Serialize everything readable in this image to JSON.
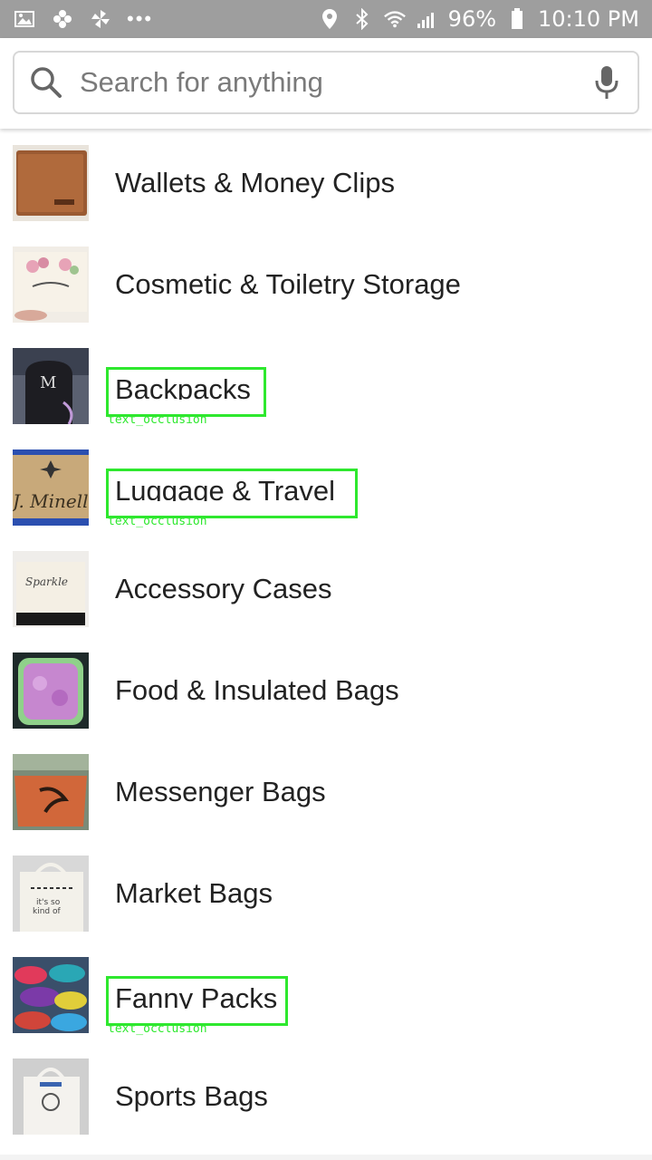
{
  "status_bar": {
    "battery": "96%",
    "time": "10:10 PM",
    "icons": [
      "gallery-icon",
      "pinwheel-icon",
      "fan-icon",
      "more-dots-icon",
      "location-icon",
      "bluetooth-icon",
      "wifi-icon",
      "signal-icon",
      "battery-icon"
    ]
  },
  "search": {
    "placeholder": "Search for anything"
  },
  "categories": [
    {
      "label": "Wallets & Money Clips"
    },
    {
      "label": "Cosmetic & Toiletry Storage"
    },
    {
      "label": "Backpacks"
    },
    {
      "label": "Luggage & Travel"
    },
    {
      "label": "Accessory Cases"
    },
    {
      "label": "Food & Insulated Bags"
    },
    {
      "label": "Messenger Bags"
    },
    {
      "label": "Market Bags"
    },
    {
      "label": "Fanny Packs"
    },
    {
      "label": "Sports Bags"
    }
  ],
  "annotations": {
    "label": "text_occlusion",
    "color": "#2ee82e"
  },
  "colors": {
    "status_bar_bg": "#9e9e9e",
    "text": "#222222",
    "placeholder": "#7a7a7a"
  }
}
